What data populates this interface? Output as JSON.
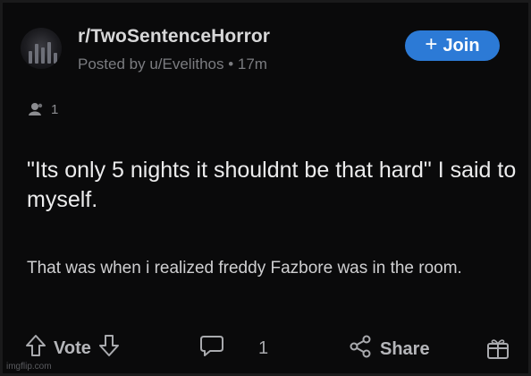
{
  "post": {
    "subreddit": "r/TwoSentenceHorror",
    "posted_by": "Posted by u/Evelithos • 17m",
    "join_label": "Join",
    "award_count": "1",
    "title": "\"Its only 5 nights it shouldnt be that hard\" I said to myself.",
    "body": "That was when i realized freddy Fazbore was in the room."
  },
  "actions": {
    "vote_label": "Vote",
    "comment_count": "1",
    "share_label": "Share"
  },
  "watermark": "imgflip.com",
  "icons": {
    "avatar": "subreddit-avatar",
    "award": "award-icon",
    "upvote": "upvote-icon",
    "downvote": "downvote-icon",
    "comment": "comment-icon",
    "share": "share-icon",
    "gift": "gift-icon"
  },
  "colors": {
    "background": "#0a0a0b",
    "join_button": "#2c7ad6",
    "text_primary": "#ececed",
    "text_secondary": "#7b7c80"
  }
}
